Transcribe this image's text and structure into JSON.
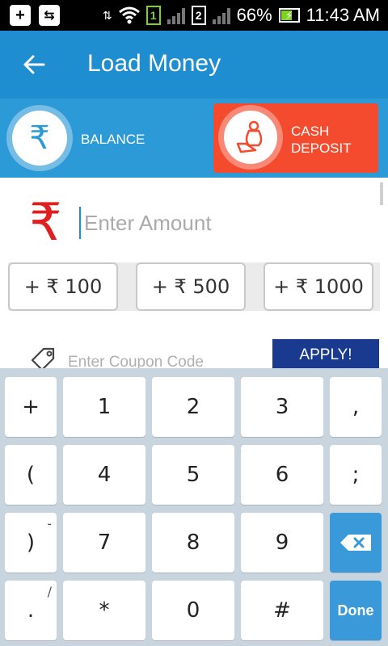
{
  "status_bar": {
    "battery_percent": "66%",
    "time": "11:43 AM",
    "sim1": "1",
    "sim2": "2"
  },
  "app_bar": {
    "title": "Load Money"
  },
  "tabs": {
    "balance_label": "BALANCE",
    "cash_deposit_label_line1": "CASH",
    "cash_deposit_label_line2": "DEPOSIT",
    "rupee_symbol": "₹"
  },
  "amount": {
    "currency_symbol": "₹",
    "placeholder": "Enter Amount"
  },
  "quick_amounts": [
    "+ ₹ 100",
    "+ ₹ 500",
    "+ ₹ 1000"
  ],
  "coupon": {
    "placeholder": "Enter Coupon Code",
    "apply_label": "APPLY!"
  },
  "keyboard": {
    "rows": [
      [
        "+",
        "1",
        "2",
        "3",
        ","
      ],
      [
        "(",
        "4",
        "5",
        "6",
        ";"
      ],
      [
        ")",
        "7",
        "8",
        "9",
        "backspace"
      ],
      [
        ".",
        "*",
        "0",
        "#",
        "Done"
      ]
    ],
    "hints": {
      "close_paren": "-",
      "period": "/"
    }
  },
  "colors": {
    "app_bar": "#1f8ed0",
    "tab_bar": "#2b9ad6",
    "cash_deposit_active": "#f44a2d",
    "apply_button": "#1a3a8f",
    "keyboard_bg": "#c8d4de",
    "keyboard_action": "#3a9ad9",
    "rupee_red": "#e02020"
  }
}
